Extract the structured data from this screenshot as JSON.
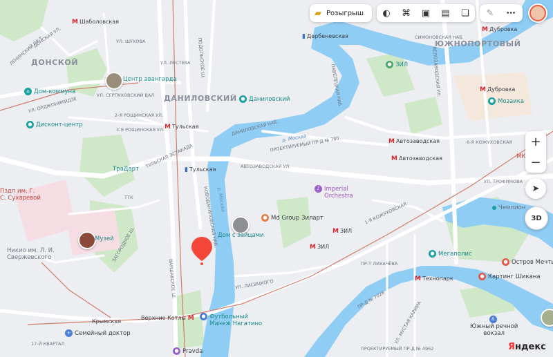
{
  "toolbar": {
    "promo_label": "Розыгрыш",
    "icons": [
      "ticket-icon",
      "layers-icon",
      "metro-map-icon",
      "camera-icon",
      "transit-icon",
      "map-layers-icon",
      "ruler-icon",
      "more-icon",
      "avatar-icon"
    ]
  },
  "controls": {
    "zoom_in": "+",
    "zoom_out": "−",
    "mode_3d": "3D"
  },
  "brand": {
    "logo": "Яндекс"
  },
  "districts": {
    "donskoy": "ДОНСКОЙ",
    "danilovsky": "ДАНИЛОВСКИЙ",
    "yuzhnoportovy": "ЮЖНОПОРТОВЫЙ"
  },
  "metro": {
    "shabolovskaya": "Шаболовская",
    "tulskaya": "Тульская",
    "avtozavodskaya": "Автозаводская",
    "avtozavodskaya2": "Автозаводская",
    "zil": "ЗИЛ",
    "zil2": "ЗИЛ",
    "tekhnopark": "Технопарк",
    "dubrovka": "Дубровка",
    "dubrovka2": "Дубровка",
    "derbenevskaya": "Дербеневская",
    "verkhnie_kotly": "Верхние Котлы",
    "krymskaya": "Крымская",
    "tulskaya_mcd": "Тульская"
  },
  "pois": {
    "center_avangarda": "Центр авангарда",
    "dom_kommuna": "Дом-коммуна",
    "diskont_centr": "Дисконт-центр",
    "danilovsky_market": "Даниловский",
    "tradart": "ТраДарт",
    "zil_park": "ЗИЛ",
    "mozaika": "Мозаика",
    "mkk": "МКК",
    "imperial_1": "Imperial",
    "imperial_2": "Orchestra",
    "md_group": "Md Group Зиларт",
    "dom_s_zaitsami": "Дом с зайцами",
    "muzei": "Музей",
    "nikio_1": "Никио им. Л. И.",
    "nikio_2": "Свержевского",
    "pzdp_1": "Пздп им. Г.",
    "pzdp_2": "С. Сухаревой",
    "megapolis": "Мегаполис",
    "ostrov_mechty": "Остров Мечты",
    "karting": "Картинг Шикана",
    "yuzhny_1": "Южный речной",
    "yuzhny_2": "вокзал",
    "football_1": "Футбольный",
    "football_2": "Манеж Нагатино",
    "semeiny_doktor": "Семейный доктор",
    "pravda": "Pravda",
    "chempion": "Чемпион"
  },
  "streets": {
    "leninsky": "ЛЕНИНСКИЙ ПР-Т",
    "donskaya": "ДОНСКАЯ УЛ.",
    "shukhova": "УЛ. ШУХОВА",
    "lestyeva": "УЛ. ЛЕСТЕВА",
    "serpukhovsky": "УЛ. СЕРПУХОВСКИЙ ВАЛ",
    "ordzhonikidze": "УЛ. ОРДЖОНИКИДЗЕ",
    "rosh2": "2-Я РОЩИНСКАЯ УЛ.",
    "rosh3": "3-Я РОЩИНСКАЯ УЛ.",
    "tulskaya_est": "ТУЛЬСКАЯ ЭСТАКАДА",
    "danilovskaya_nab": "ДАНИЛОВСКАЯ НАБ.",
    "avtozavodskaya_ul": "АВТОЗАВОДСКАЯ УЛ.",
    "proektiruemy": "ПРОЕКТИРУЕМЫЙ ПР-Д № 780",
    "novodanilovskaya": "НОВОДАНИЛОВСКАЯ НАБ.",
    "varshavskoe": "ВАРШАВСКОЕ Ш.",
    "zagorodnoe": "ЗАГОРОДНОЕ Ш.",
    "lisichkogo": "УЛ. ЛИСИЦКОГО",
    "likhacheva": "ПР-Т ЛИХАЧЁВА",
    "kozhukhovskaya": "1-Я КОЖУХОВСКАЯ",
    "trofimova": "УЛ. ТРОФИМОВА",
    "velozavodskaya": "ВЕЛОЗАВОДСКАЯ УЛ.",
    "pavelezkaya": "ПАВЕЛЕЦКАЯ НАБ.",
    "podolskoe": "ПОДОЛЬСКОЕ Ш.",
    "ttk": "ТТК",
    "kvartal": "17-Й КВАРТАЛ",
    "ryazansky": "УЛ. МУСТАЯ КАРИМА",
    "proezd4962": "ПРОЕКТИРУЕМЫЙ ПР-Д № 4962",
    "proezd7026": "ПР-Д № 7026",
    "simonovskaya": "СИМОНОВСКАЯ НАБ.",
    "avtozavodsk_6": "6-Я КОЖУХОВСКАЯ"
  },
  "river": {
    "name": "р. Москва",
    "name2": "р. Москва"
  },
  "colors": {
    "water": "#8fcdf4",
    "park": "#c8e8c4",
    "road": "#ffffff",
    "metro_red": "#d9262e",
    "marker": "#f5463a",
    "accent_teal": "#19a0a0"
  }
}
